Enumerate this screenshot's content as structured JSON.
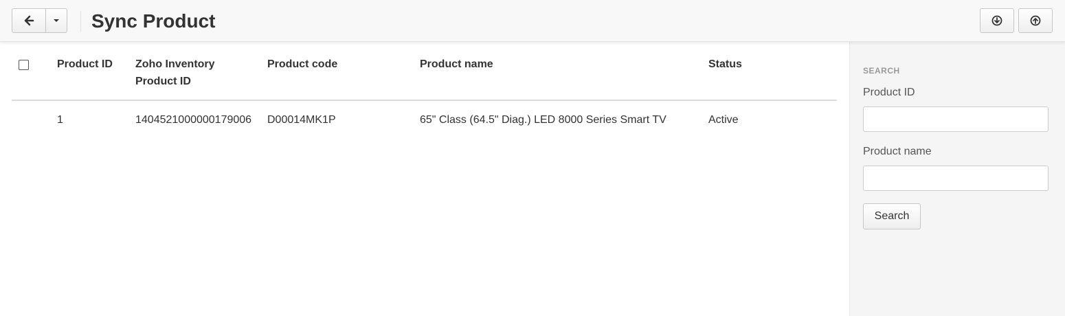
{
  "header": {
    "title": "Sync Product",
    "back_icon": "arrow-left-icon",
    "caret_icon": "caret-down-icon",
    "download_icon": "circle-arrow-down-icon",
    "upload_icon": "circle-arrow-up-icon"
  },
  "table": {
    "columns": [
      {
        "line1": "Product ID",
        "line2": ""
      },
      {
        "line1": "Zoho Inventory",
        "line2": "Product ID"
      },
      {
        "line1": "Product code",
        "line2": ""
      },
      {
        "line1": "Product name",
        "line2": ""
      },
      {
        "line1": "Status",
        "line2": ""
      }
    ],
    "rows": [
      {
        "product_id": "1",
        "zoho_product_id": "1404521000000179006",
        "product_code": "D00014MK1P",
        "product_name": "65\" Class (64.5\" Diag.) LED 8000 Series Smart TV",
        "status": "Active"
      }
    ]
  },
  "sidebar": {
    "title": "SEARCH",
    "product_id_label": "Product ID",
    "product_id_value": "",
    "product_name_label": "Product name",
    "product_name_value": "",
    "search_button": "Search"
  }
}
